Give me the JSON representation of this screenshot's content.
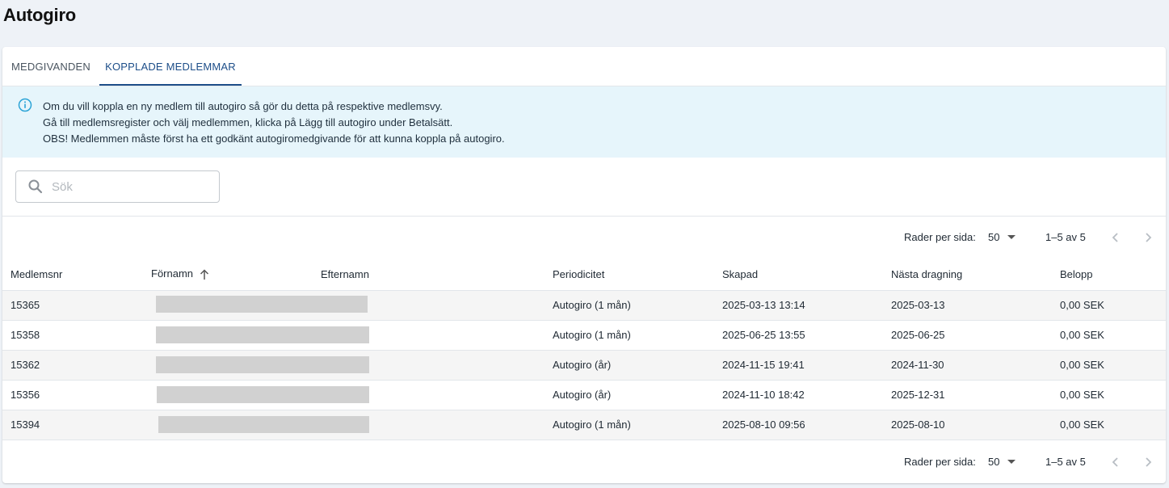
{
  "page": {
    "title": "Autogiro"
  },
  "tabs": [
    {
      "label": "MEDGIVANDEN",
      "active": false
    },
    {
      "label": "KOPPLADE MEDLEMMAR",
      "active": true
    }
  ],
  "info": {
    "icon": "info-icon",
    "lines": [
      "Om du vill koppla en ny medlem till autogiro så gör du detta på respektive medlemsvy.",
      "Gå till medlemsregister och välj medlemmen, klicka på Lägg till autogiro under Betalsätt.",
      "OBS! Medlemmen måste först ha ett godkänt autogiromedgivande för att kunna koppla på autogiro."
    ]
  },
  "search": {
    "placeholder": "Sök",
    "value": ""
  },
  "pagination": {
    "rows_per_page_label": "Rader per sida:",
    "rows_per_page": "50",
    "range": "1–5 av 5"
  },
  "table": {
    "columns": [
      "Medlemsnr",
      "Förnamn",
      "Efternamn",
      "Periodicitet",
      "Skapad",
      "Nästa dragning",
      "Belopp"
    ],
    "rows": [
      {
        "medlemsnr": "15365",
        "periodicitet": "Autogiro (1 mån)",
        "skapad": "2025-03-13 13:14",
        "nasta": "2025-03-13",
        "belopp": "0,00 SEK"
      },
      {
        "medlemsnr": "15358",
        "periodicitet": "Autogiro (1 mån)",
        "skapad": "2025-06-25 13:55",
        "nasta": "2025-06-25",
        "belopp": "0,00 SEK"
      },
      {
        "medlemsnr": "15362",
        "periodicitet": "Autogiro (år)",
        "skapad": "2024-11-15 19:41",
        "nasta": "2024-11-30",
        "belopp": "0,00 SEK"
      },
      {
        "medlemsnr": "15356",
        "periodicitet": "Autogiro (år)",
        "skapad": "2024-11-10 18:42",
        "nasta": "2025-12-31",
        "belopp": "0,00 SEK"
      },
      {
        "medlemsnr": "15394",
        "periodicitet": "Autogiro (1 mån)",
        "skapad": "2025-08-10 09:56",
        "nasta": "2025-08-10",
        "belopp": "0,00 SEK"
      }
    ]
  },
  "colors": {
    "primary": "#1d4e89",
    "info_bg": "#e6f5fb",
    "info_icon": "#2aa3d6",
    "page_bg": "#eef2f7"
  }
}
